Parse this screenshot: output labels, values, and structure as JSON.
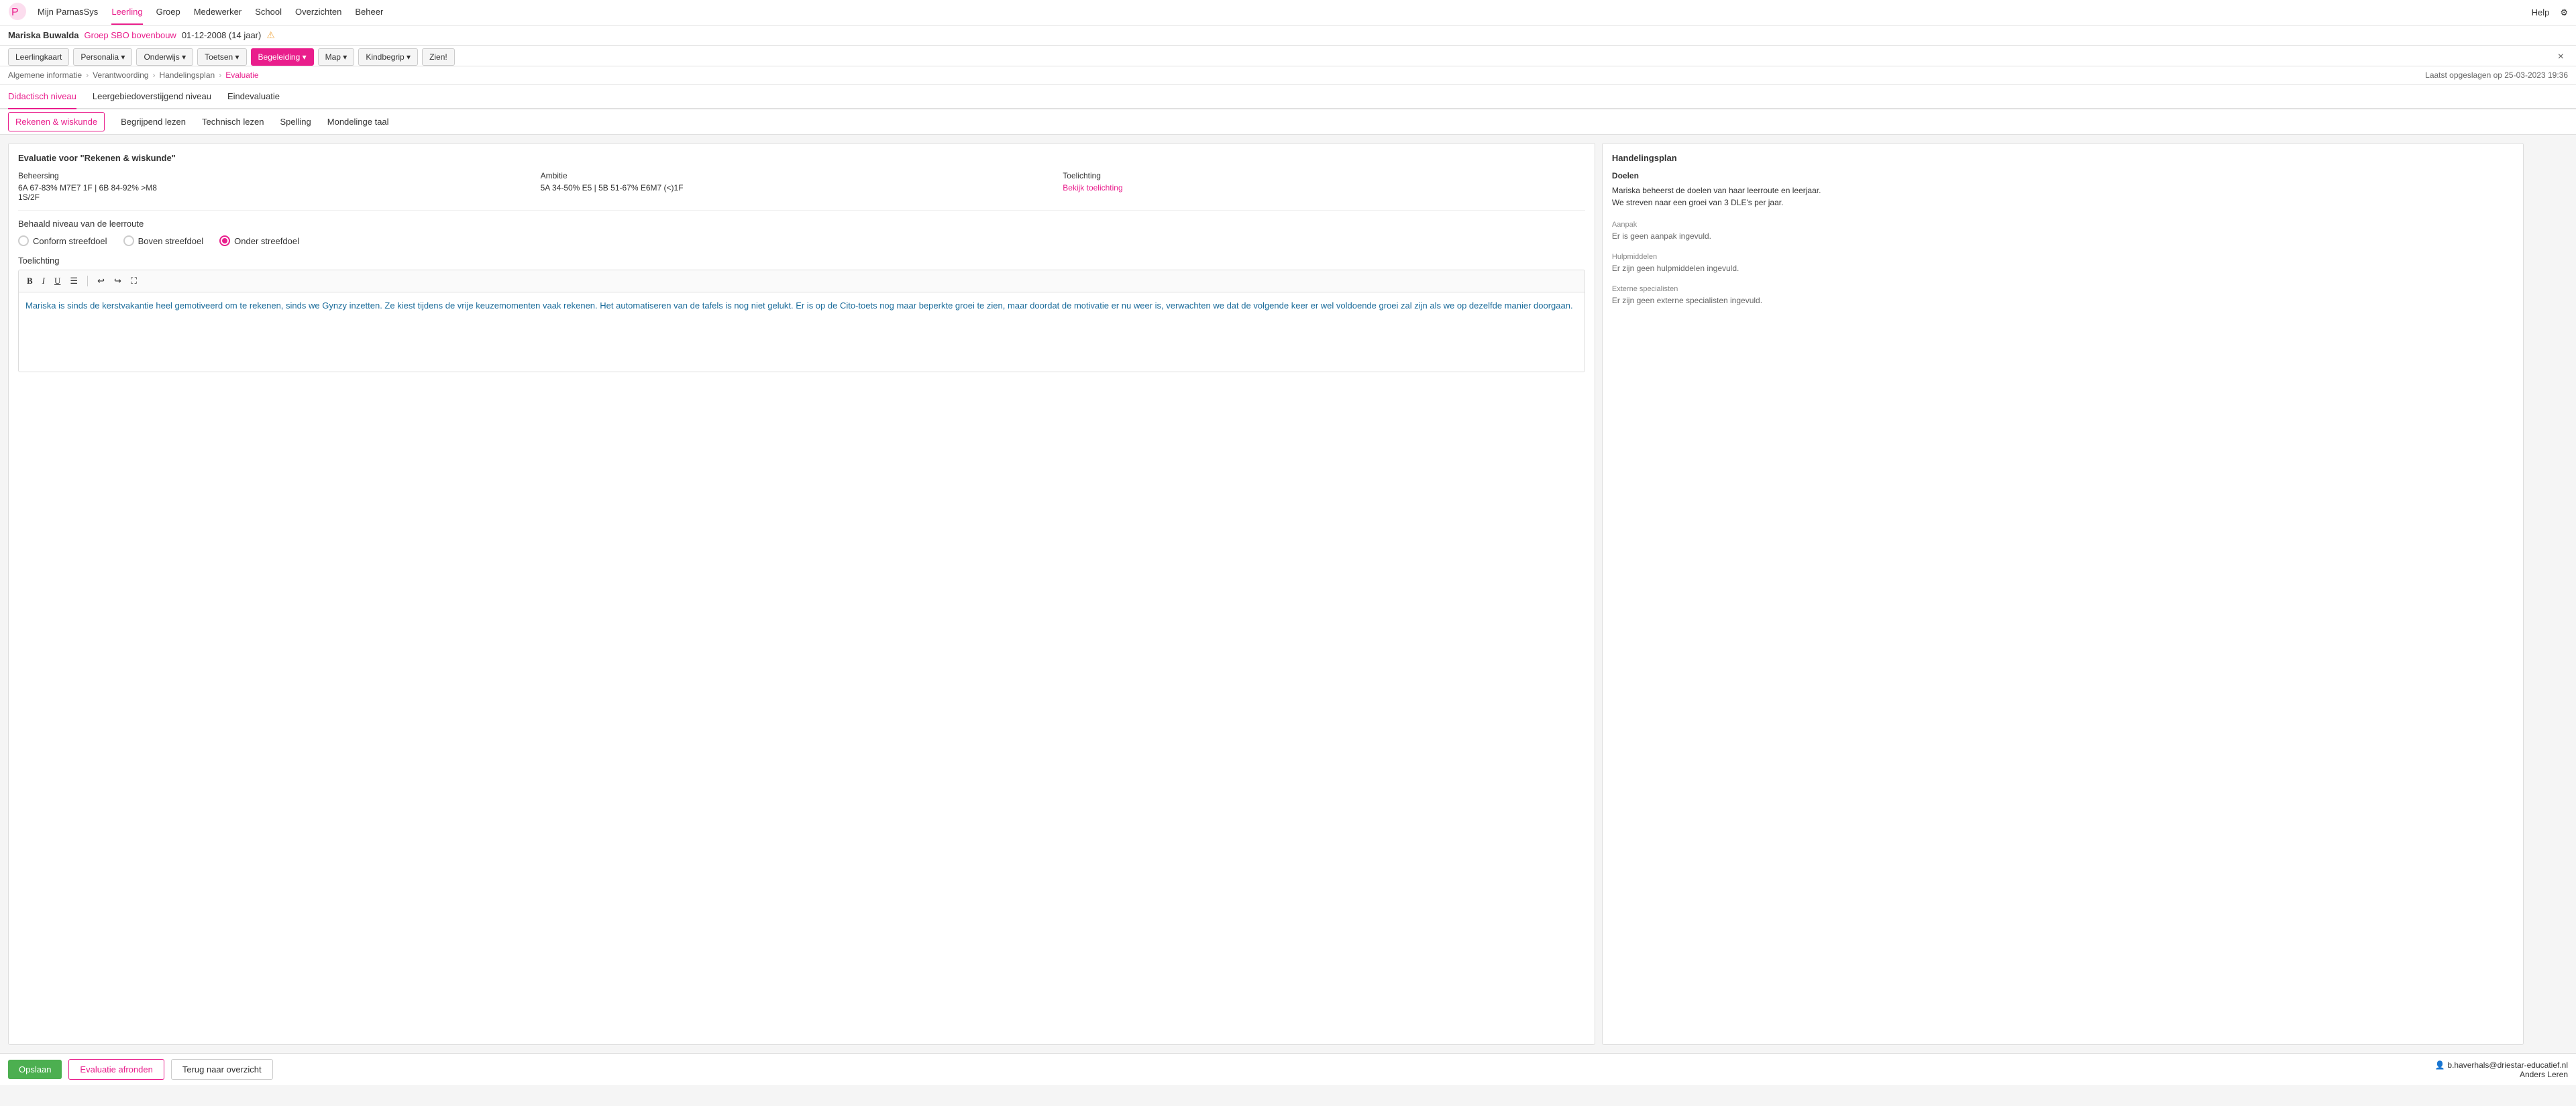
{
  "app": {
    "logo_alt": "ParnasSys",
    "nav": {
      "items": [
        {
          "label": "Mijn ParnasSys",
          "active": false
        },
        {
          "label": "Leerling",
          "active": true
        },
        {
          "label": "Groep",
          "active": false
        },
        {
          "label": "Medewerker",
          "active": false
        },
        {
          "label": "School",
          "active": false
        },
        {
          "label": "Overzichten",
          "active": false
        },
        {
          "label": "Beheer",
          "active": false
        }
      ],
      "help": "Help",
      "settings_icon": "⚙"
    }
  },
  "student": {
    "name": "Mariska Buwalda",
    "group": "Groep SBO bovenbouw",
    "dob": "01-12-2008 (14 jaar)",
    "warning": "⚠"
  },
  "tab_bar": {
    "tabs": [
      {
        "label": "Leerlingkaart",
        "active": false,
        "dropdown": false
      },
      {
        "label": "Personalia",
        "active": false,
        "dropdown": true
      },
      {
        "label": "Onderwijs",
        "active": false,
        "dropdown": true
      },
      {
        "label": "Toetsen",
        "active": false,
        "dropdown": true
      },
      {
        "label": "Begeleiding",
        "active": true,
        "dropdown": true
      },
      {
        "label": "Map",
        "active": false,
        "dropdown": true
      },
      {
        "label": "Kindbegrip",
        "active": false,
        "dropdown": true
      },
      {
        "label": "Zien!",
        "active": false,
        "dropdown": false
      }
    ],
    "close": "×"
  },
  "breadcrumb": {
    "items": [
      {
        "label": "Algemene informatie",
        "active": false
      },
      {
        "label": "Verantwoording",
        "active": false
      },
      {
        "label": "Handelingsplan",
        "active": false
      },
      {
        "label": "Evaluatie",
        "active": true
      }
    ],
    "last_saved": "Laatst opgeslagen op 25-03-2023 19:36"
  },
  "main_tabs": [
    {
      "label": "Didactisch niveau",
      "active": true
    },
    {
      "label": "Leergebiedoverstijgend niveau",
      "active": false
    },
    {
      "label": "Eindevaluatie",
      "active": false
    }
  ],
  "sub_tabs": [
    {
      "label": "Rekenen & wiskunde",
      "active": true
    },
    {
      "label": "Begrijpend lezen",
      "active": false
    },
    {
      "label": "Technisch lezen",
      "active": false
    },
    {
      "label": "Spelling",
      "active": false
    },
    {
      "label": "Mondelinge taal",
      "active": false
    }
  ],
  "left_panel": {
    "title": "Evaluatie voor \"Rekenen & wiskunde\"",
    "eval_cols": [
      {
        "label": "Beheersing",
        "value": "6A 67-83% M7E7 1F | 6B 84-92% >M8\n1S/2F"
      },
      {
        "label": "Ambitie",
        "value": "5A 34-50% E5 | 5B 51-67% E6M7 (<)1F"
      },
      {
        "label": "Toelichting",
        "value": "Bekijk toelichting",
        "is_link": true
      }
    ],
    "niveau_section": {
      "title": "Behaald niveau van de leerroute",
      "options": [
        {
          "label": "Conform streefdoel",
          "selected": false
        },
        {
          "label": "Boven streefdoel",
          "selected": false
        },
        {
          "label": "Onder streefdoel",
          "selected": true
        }
      ]
    },
    "toelichting": {
      "label": "Toelichting",
      "toolbar": {
        "bold": "B",
        "italic": "I",
        "underline": "U",
        "list": "☰",
        "undo": "↩",
        "redo": "↪",
        "expand": "⛶"
      },
      "text": "Mariska is sinds de kerstvakantie heel gemotiveerd om te rekenen, sinds we Gynzy inzetten. Ze kiest tijdens de vrije keuzemomenten vaak rekenen. Het automatiseren van de tafels is nog niet gelukt. Er is op de Cito-toets nog maar beperkte groei te zien, maar doordat de motivatie er nu weer is, verwachten we dat de volgende keer er wel voldoende groei zal zijn als we op dezelfde manier doorgaan."
    }
  },
  "right_panel": {
    "title": "Handelingsplan",
    "sections": [
      {
        "label": "Doelen",
        "text": "Mariska beheerst de doelen van haar leerroute en leerjaar.\nWe streven naar een groei van 3 DLE's per jaar.",
        "empty": false
      },
      {
        "label": "Aanpak",
        "text": "Er is geen aanpak ingevuld.",
        "empty": true
      },
      {
        "label": "Hulpmiddelen",
        "text": "Er zijn geen hulpmiddelen ingevuld.",
        "empty": true
      },
      {
        "label": "Externe specialisten",
        "text": "Er zijn geen externe specialisten ingevuld.",
        "empty": true
      }
    ]
  },
  "footer": {
    "save_label": "Opslaan",
    "afronden_label": "Evaluatie afronden",
    "terug_label": "Terug naar overzicht",
    "user_icon": "👤",
    "user_email": "b.haverhals@driestar-educatief.nl",
    "user_org": "Anders Leren"
  }
}
